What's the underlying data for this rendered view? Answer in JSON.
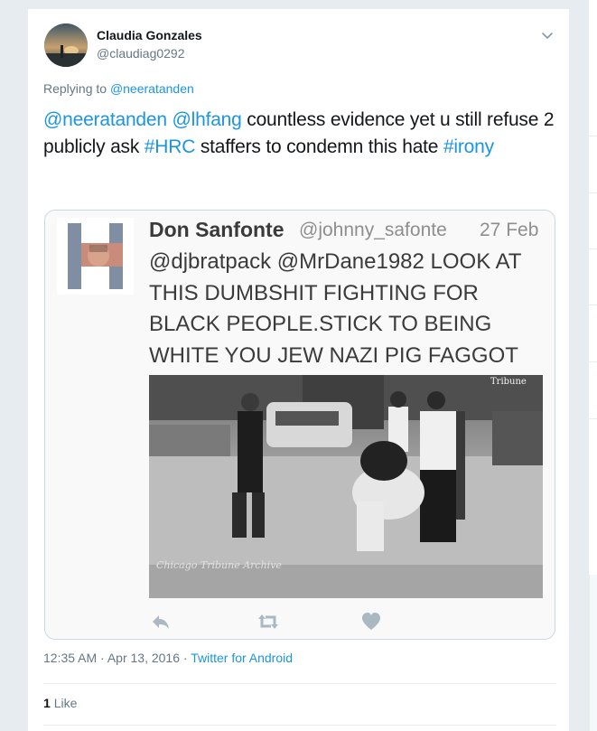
{
  "tweet": {
    "author_name": "Claudia Gonzales",
    "author_handle": "@claudiag0292",
    "replying_prefix": "Replying to",
    "replying_to": "@neeratanden",
    "text_parts": {
      "mention1": "@neeratanden",
      "mention2": "@lhfang",
      "text1": " countless evidence yet u still refuse 2 publicly ask ",
      "hashtag1": "#HRC",
      "text2": " staffers to condemn this hate ",
      "hashtag2": "#irony"
    },
    "time": "12:35 AM",
    "separator": " · ",
    "date": "Apr 13, 2016",
    "source": "Twitter for Android",
    "likes_count": "1",
    "likes_label": "Like"
  },
  "embedded_screenshot": {
    "name": "Don Sanfonte",
    "handle": "@johnny_safonte",
    "date": "27 Feb",
    "body": "@djbratpack @MrDane1982 LOOK AT THIS DUMBSHIT FIGHTING FOR BLACK PEOPLE.STICK TO BEING WHITE YOU JEW NAZI PIG FAGGOT",
    "photo_watermark_top": "Tribune",
    "photo_watermark_bottom": "Chicago Tribune Archive"
  },
  "colors": {
    "link": "#1b95e0",
    "secondary_text": "#657786",
    "border": "#e6ecf0"
  },
  "icons": {
    "caret": "chevron-down-icon",
    "reply": "reply-icon",
    "retweet": "retweet-icon",
    "like": "heart-icon"
  }
}
